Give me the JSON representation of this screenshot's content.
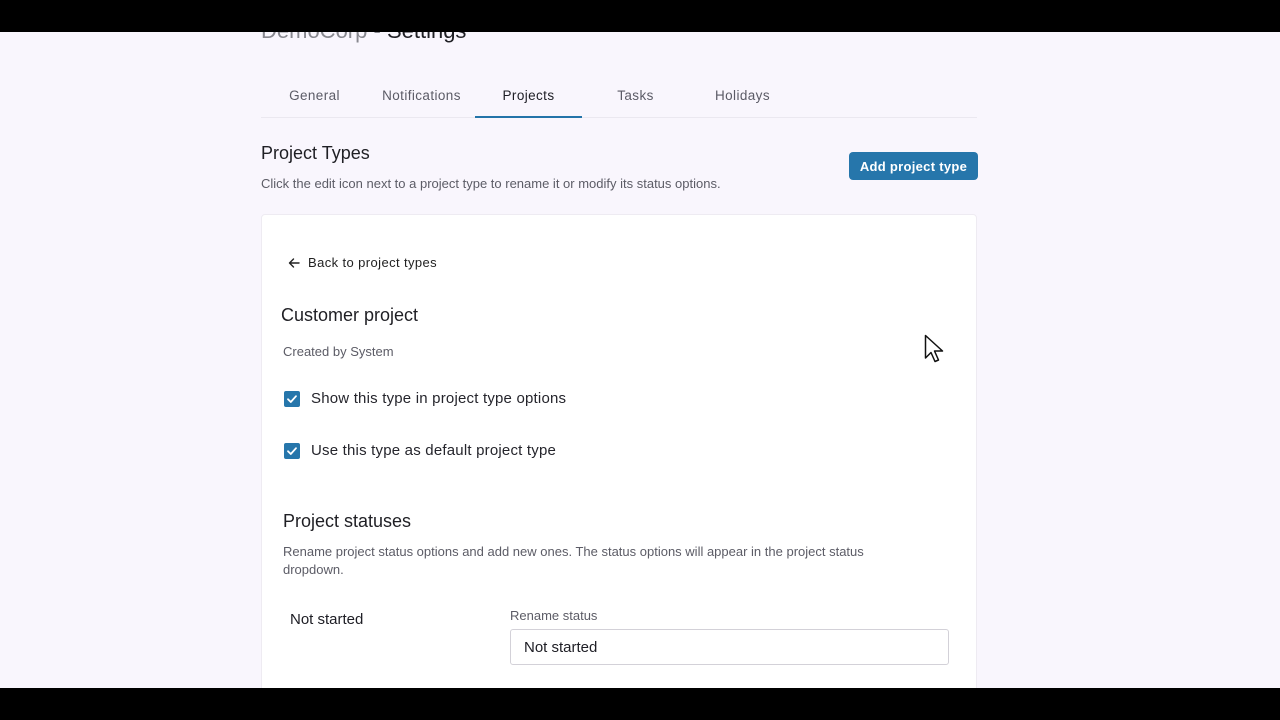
{
  "header": {
    "org_name": "DemoCorp",
    "separator": " - ",
    "title": "Settings"
  },
  "tabs": [
    {
      "label": "General",
      "active": false
    },
    {
      "label": "Notifications",
      "active": false
    },
    {
      "label": "Projects",
      "active": true
    },
    {
      "label": "Tasks",
      "active": false
    },
    {
      "label": "Holidays",
      "active": false
    }
  ],
  "section": {
    "title": "Project Types",
    "description": "Click the edit icon next to a project type to rename it or modify its status options.",
    "add_button_label": "Add project type"
  },
  "detail": {
    "back_label": "Back to project types",
    "type_name": "Customer project",
    "created_by": "Created by System",
    "options": [
      {
        "label": "Show this type in project type options",
        "checked": true
      },
      {
        "label": "Use this type as default project type",
        "checked": true
      }
    ],
    "statuses": {
      "title": "Project statuses",
      "description": "Rename project status options and add new ones. The status options will appear in the project status dropdown.",
      "rows": [
        {
          "name": "Not started",
          "rename_label": "Rename status",
          "value": "Not started"
        }
      ]
    }
  },
  "colors": {
    "accent": "#2676ab",
    "page_background": "#f9f6fd"
  }
}
